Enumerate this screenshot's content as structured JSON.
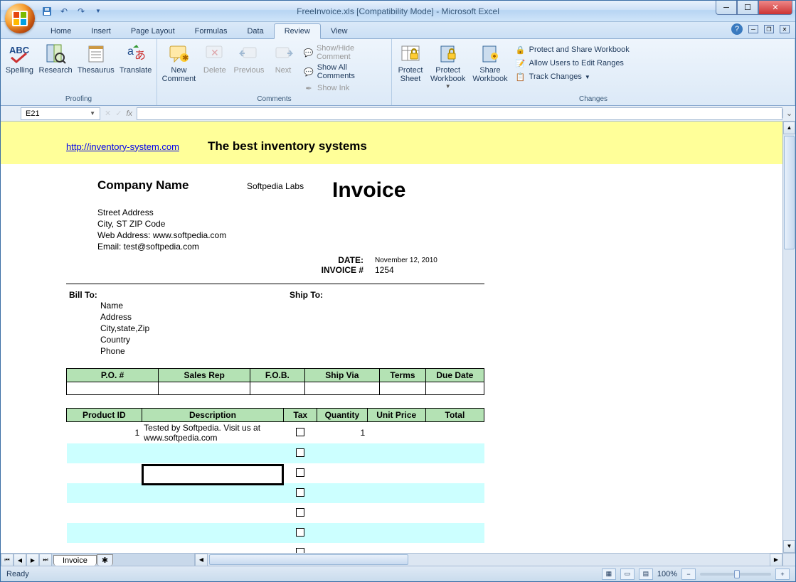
{
  "window": {
    "title": "FreeInvoice.xls  [Compatibility Mode] - Microsoft Excel"
  },
  "tabs": {
    "items": [
      "Home",
      "Insert",
      "Page Layout",
      "Formulas",
      "Data",
      "Review",
      "View"
    ],
    "active": "Review"
  },
  "ribbon": {
    "proofing": {
      "label": "Proofing",
      "spelling": "Spelling",
      "research": "Research",
      "thesaurus": "Thesaurus",
      "translate": "Translate"
    },
    "comments": {
      "label": "Comments",
      "new": "New\nComment",
      "delete": "Delete",
      "previous": "Previous",
      "next": "Next",
      "showhide": "Show/Hide Comment",
      "showall": "Show All Comments",
      "showink": "Show Ink"
    },
    "changes": {
      "label": "Changes",
      "protectsheet": "Protect\nSheet",
      "protectwb": "Protect\nWorkbook",
      "sharewb": "Share\nWorkbook",
      "protectshare": "Protect and Share Workbook",
      "allowedit": "Allow Users to Edit Ranges",
      "track": "Track Changes"
    }
  },
  "formulaBar": {
    "cellRef": "E21",
    "fx": "fx"
  },
  "invoice": {
    "link": "http://inventory-system.com",
    "tagline": "The best inventory systems",
    "companyLabel": "Company Name",
    "companySub": "Softpedia Labs",
    "title": "Invoice",
    "addr1": "Street Address",
    "addr2": "City, ST  ZIP Code",
    "addr3": "Web Address: www.softpedia.com",
    "addr4": "Email: test@softpedia.com",
    "dateLabel": "DATE:",
    "dateVal": "November 12, 2010",
    "invnoLabel": "INVOICE #",
    "invnoVal": "1254",
    "billto": "Bill To:",
    "shipto": "Ship To:",
    "billName": "Name",
    "billAddr": "Address",
    "billCity": "City,state,Zip",
    "billCountry": "Country",
    "billPhone": "Phone",
    "cols1": [
      "P.O. #",
      "Sales Rep",
      "F.O.B.",
      "Ship Via",
      "Terms",
      "Due Date"
    ],
    "cols2": [
      "Product ID",
      "Description",
      "Tax",
      "Quantity",
      "Unit Price",
      "Total"
    ],
    "row1_id": "1",
    "row1_desc": "Tested by Softpedia. Visit us at www.softpedia.com",
    "row1_qty": "1"
  },
  "sheetTab": "Invoice",
  "status": {
    "ready": "Ready",
    "zoom": "100%"
  }
}
